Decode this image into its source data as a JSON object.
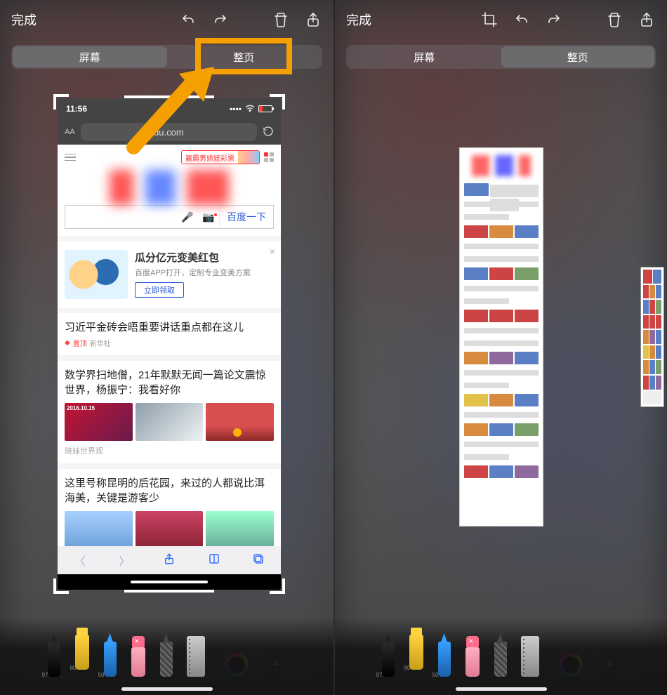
{
  "toolbar": {
    "done": "完成",
    "icons": {
      "undo": "undo",
      "redo": "redo",
      "crop": "crop",
      "trash": "trash",
      "share": "share"
    }
  },
  "segmented": {
    "screen": "屏幕",
    "fullpage": "整页"
  },
  "phone": {
    "time": "11:56",
    "url_text": "du.com",
    "aa": "AA",
    "top_promo": "赢霸男娇娃彩票",
    "search_button": "百度一下",
    "promo": {
      "title": "瓜分亿元变美红包",
      "subtitle": "百度APP打开，定制专业变美方案",
      "cta": "立即领取"
    },
    "news1": {
      "headline": "习近平金砖会晤重要讲话重点都在这儿",
      "pin": "置顶",
      "source": "新华社"
    },
    "news2": {
      "headline": "数学界扫地僧，21年默默无闻一篇论文震惊世界，杨振宁：我看好你",
      "date_overlay": "2016.10.15",
      "source": "晓妹世界观"
    },
    "news3": {
      "headline": "这里号称昆明的后花园，来过的人都说比洱海美，关键是游客少"
    }
  },
  "tools": {
    "pen_size": "97",
    "highlighter_size": "80",
    "pencil_size": "50"
  },
  "colors": {
    "highlight": "#f5a000",
    "accent_blue": "#2858d8"
  }
}
